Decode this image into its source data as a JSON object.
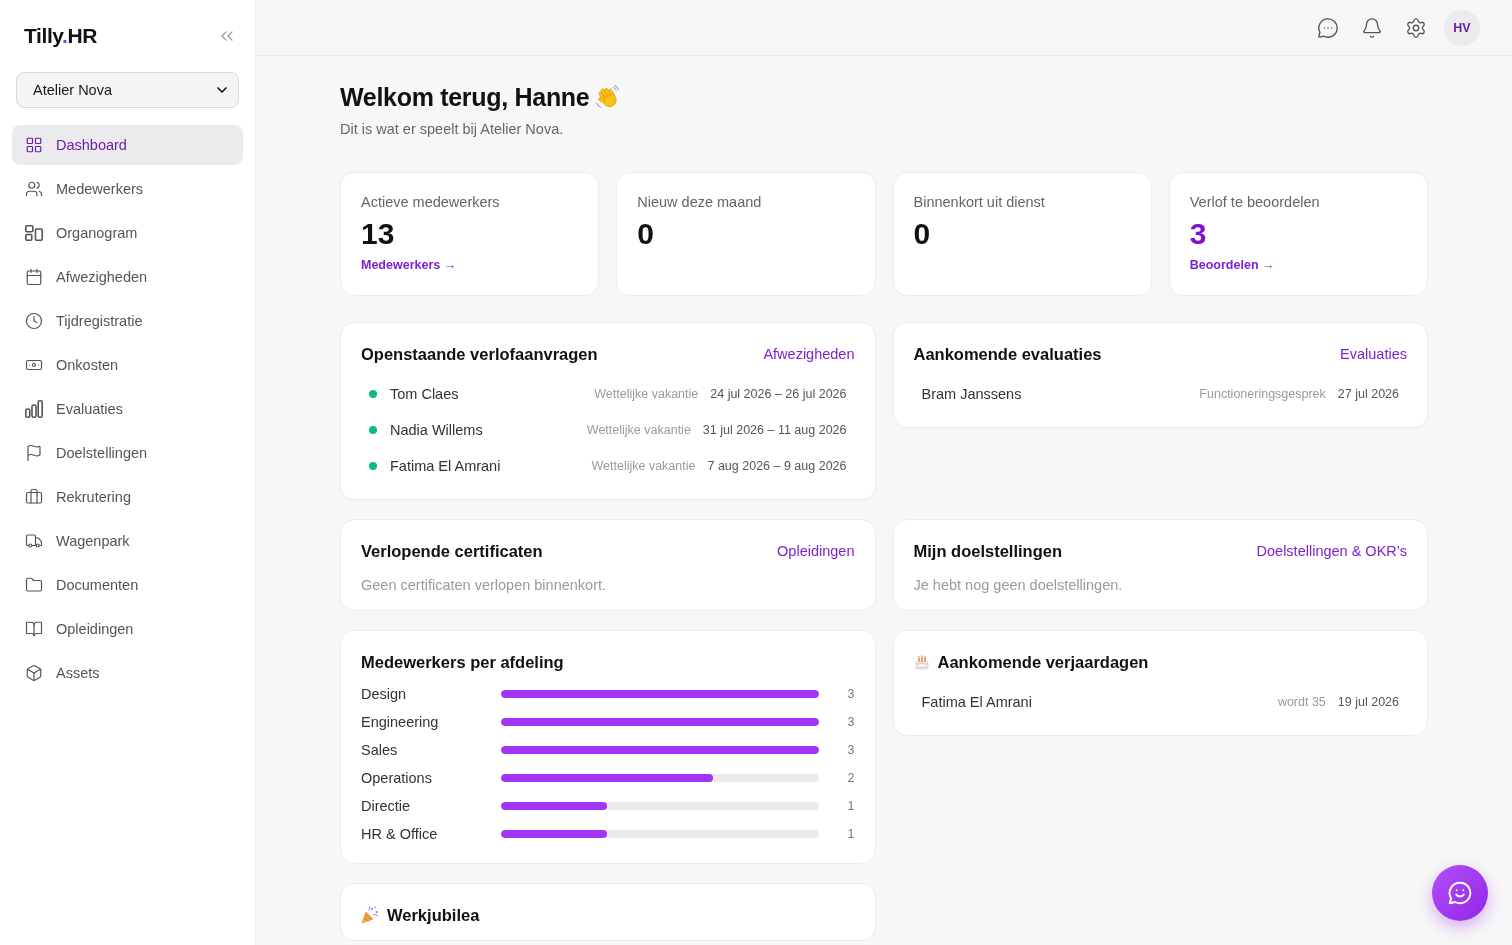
{
  "sidebar": {
    "logo": {
      "prefix": "Tilly",
      "accent": ".",
      "suffix": "HR"
    },
    "company": "Atelier Nova",
    "nav": [
      {
        "label": "Dashboard",
        "selected": true
      },
      {
        "label": "Medewerkers",
        "selected": false
      },
      {
        "label": "Organogram",
        "selected": false
      },
      {
        "label": "Afwezigheden",
        "selected": false
      },
      {
        "label": "Tijdregistratie",
        "selected": false
      },
      {
        "label": "Onkosten",
        "selected": false
      },
      {
        "label": "Evaluaties",
        "selected": false
      },
      {
        "label": "Doelstellingen",
        "selected": false
      },
      {
        "label": "Rekrutering",
        "selected": false
      },
      {
        "label": "Wagenpark",
        "selected": false
      },
      {
        "label": "Documenten",
        "selected": false
      },
      {
        "label": "Opleidingen",
        "selected": false
      },
      {
        "label": "Assets",
        "selected": false
      }
    ]
  },
  "header": {
    "avatar": "HV"
  },
  "welcome": {
    "title": "Welkom terug, Hanne",
    "subtitle": "Dit is wat er speelt bij Atelier Nova."
  },
  "stats": [
    {
      "label": "Actieve medewerkers",
      "value": "13",
      "highlighted": false,
      "link": "Medewerkers →"
    },
    {
      "label": "Nieuw deze maand",
      "value": "0",
      "highlighted": false
    },
    {
      "label": "Binnenkort uit dienst",
      "value": "0",
      "highlighted": false
    },
    {
      "label": "Verlof te beoordelen",
      "value": "3",
      "highlighted": true,
      "link": "Beoordelen →"
    }
  ],
  "leave_requests": {
    "title": "Openstaande verlofaanvragen",
    "link": "Afwezigheden",
    "rows": [
      {
        "name": "Tom Claes",
        "type": "Wettelijke vakantie",
        "period": "24 jul 2026 – 26 jul 2026"
      },
      {
        "name": "Nadia Willems",
        "type": "Wettelijke vakantie",
        "period": "31 jul 2026 – 11 aug 2026"
      },
      {
        "name": "Fatima El Amrani",
        "type": "Wettelijke vakantie",
        "period": "7 aug 2026 – 9 aug 2026"
      }
    ]
  },
  "evaluations": {
    "title": "Aankomende evaluaties",
    "link": "Evaluaties",
    "rows": [
      {
        "name": "Bram Janssens",
        "type": "Functioneringsgesprek",
        "date": "27 jul 2026"
      }
    ]
  },
  "certificates": {
    "title": "Verlopende certificaten",
    "link": "Opleidingen",
    "empty": "Geen certificaten verlopen binnenkort."
  },
  "goals": {
    "title": "Mijn doelstellingen",
    "link": "Doelstellingen & OKR’s",
    "empty": "Je hebt nog geen doelstellingen."
  },
  "departments": {
    "title": "Medewerkers per afdeling",
    "rows": [
      {
        "name": "Design",
        "level": 1,
        "count": "3"
      },
      {
        "name": "Engineering",
        "level": 1,
        "count": "3"
      },
      {
        "name": "Sales",
        "level": 1,
        "count": "3"
      },
      {
        "name": "Operations",
        "level": 0.667,
        "count": "2"
      },
      {
        "name": "Directie",
        "level": 0.333,
        "count": "1"
      },
      {
        "name": "HR & Office",
        "level": 0.333,
        "count": "1"
      }
    ]
  },
  "birthdays": {
    "title": "Aankomende verjaardagen",
    "rows": [
      {
        "name": "Fatima El Amrani",
        "note": "wordt 35",
        "date": "19 jul 2026"
      }
    ]
  },
  "anniversaries": {
    "title": "Werkjubilea"
  }
}
